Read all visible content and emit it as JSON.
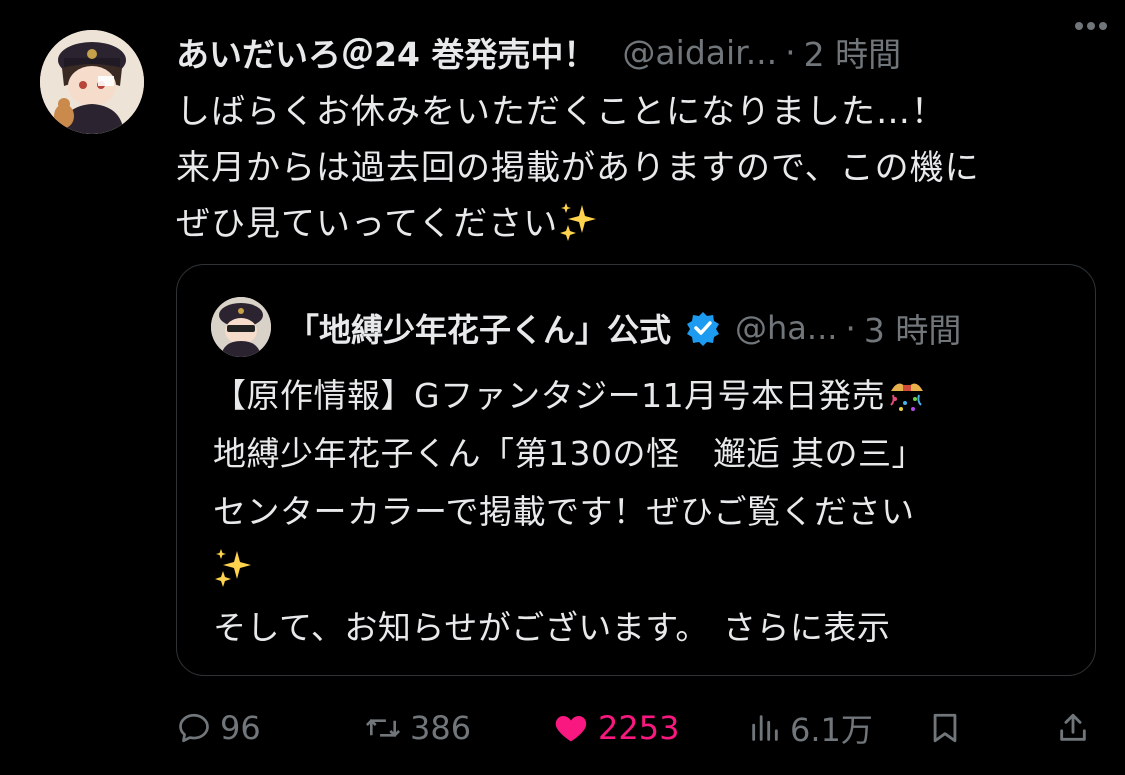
{
  "tweet": {
    "display_name": "あいだいろ＠24 巻発売中！",
    "handle": "@aidair...",
    "separator": "·",
    "time": "2 時間",
    "text_lines": [
      "しばらくお休みをいただくことになりました…！",
      "来月からは過去回の掲載がありますので、この機に",
      "ぜひ見ていってください"
    ]
  },
  "quote": {
    "display_name": "「地縛少年花子くん」公式",
    "handle": "@ha...",
    "separator": "·",
    "time": "3 時間",
    "text_lines": [
      "【原作情報】Gファンタジー11月号本日発売",
      "地縛少年花子くん「第130の怪　邂逅 其の三」",
      "センターカラーで掲載です！ぜひご覧ください",
      "",
      "そして、お知らせがございます。"
    ],
    "show_more": "さらに表示"
  },
  "actions": {
    "reply_count": "96",
    "repost_count": "386",
    "like_count": "2253",
    "views_count": "6.1万"
  },
  "icons": {
    "more": "more-dots-icon",
    "verified": "verified-badge-icon",
    "reply": "reply-icon",
    "repost": "repost-icon",
    "like": "heart-icon",
    "views": "views-icon",
    "bookmark": "bookmark-icon",
    "share": "share-icon",
    "sparkles": "sparkles-emoji",
    "party": "party-popper-emoji"
  },
  "colors": {
    "background": "#000000",
    "text": "#e7e9ea",
    "secondary": "#71767b",
    "like": "#f91880",
    "verified": "#1d9bf0",
    "border": "#2f3336"
  }
}
